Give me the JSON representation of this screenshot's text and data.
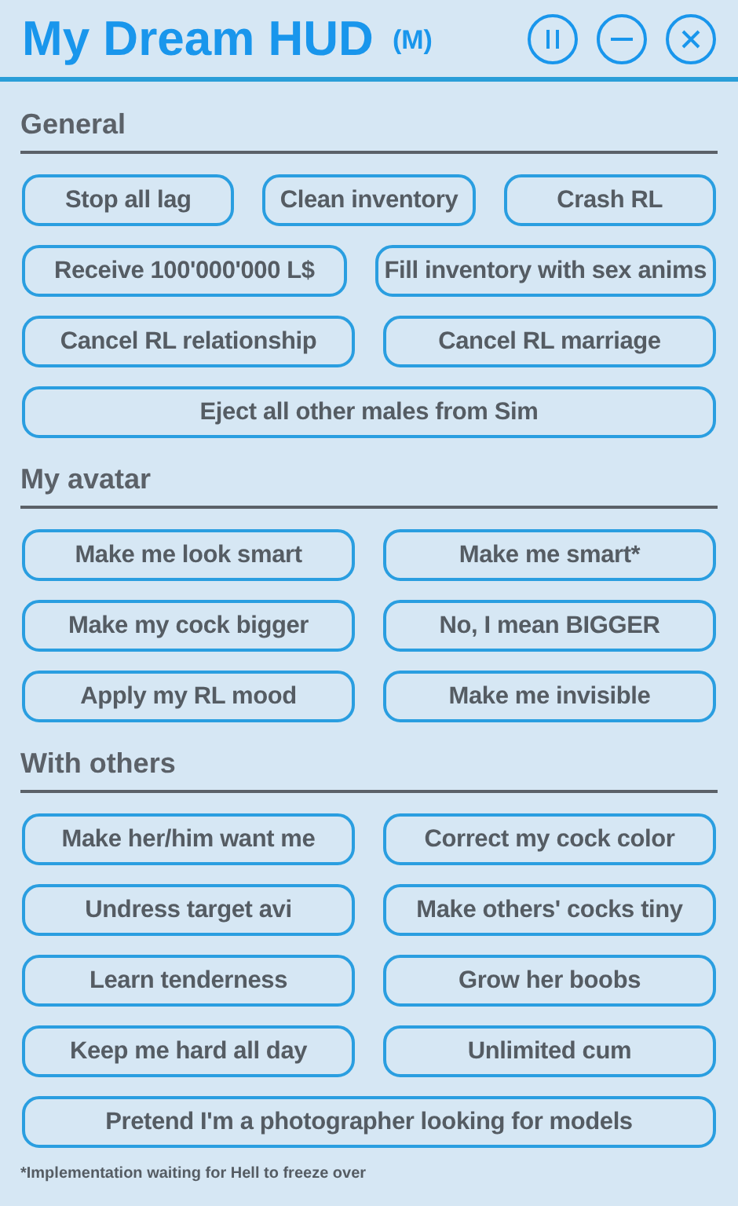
{
  "window": {
    "title": "My Dream HUD",
    "badge": "(M)",
    "controls": [
      {
        "kind": "pause"
      },
      {
        "kind": "minimize"
      },
      {
        "kind": "close"
      }
    ]
  },
  "sections": [
    {
      "heading": "General",
      "rows": [
        [
          "Stop all lag",
          "Clean inventory",
          "Crash RL"
        ],
        [
          "Receive 100'000'000 L$",
          "Fill inventory with sex anims"
        ],
        [
          "Cancel RL relationship",
          "Cancel RL marriage"
        ],
        [
          "Eject all other males from Sim"
        ]
      ]
    },
    {
      "heading": "My avatar",
      "rows": [
        [
          "Make me look smart",
          "Make me smart*"
        ],
        [
          "Make my cock bigger",
          "No, I mean BIGGER"
        ],
        [
          "Apply my RL mood",
          "Make me invisible"
        ]
      ]
    },
    {
      "heading": "With others",
      "rows": [
        [
          "Make her/him want me",
          "Correct my cock color"
        ],
        [
          "Undress target avi",
          "Make others' cocks tiny"
        ],
        [
          "Learn tenderness",
          "Grow her boobs"
        ],
        [
          "Keep me hard all day",
          "Unlimited cum"
        ],
        [
          "Pretend I'm a photographer looking for models"
        ]
      ]
    }
  ],
  "footnote": "*Implementation waiting for Hell to freeze over"
}
